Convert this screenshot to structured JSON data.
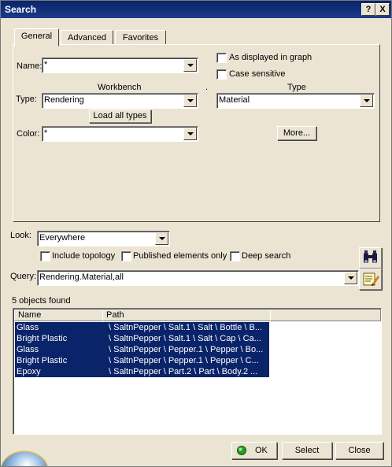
{
  "window": {
    "title": "Search",
    "help": "?",
    "close": "X"
  },
  "tabs": [
    {
      "label": "General"
    },
    {
      "label": "Advanced"
    },
    {
      "label": "Favorites"
    }
  ],
  "general": {
    "name_label": "Name:",
    "name_value": "*",
    "workbench_label": "Workbench",
    "type_label": "Type:",
    "type_value": "Rendering",
    "load_all_types": "Load all types",
    "color_label": "Color:",
    "color_value": "*",
    "as_displayed": "As displayed in graph",
    "case_sensitive": "Case sensitive",
    "type2_label": "Type",
    "type2_value": "Material",
    "more_button": "More...",
    "separator": "."
  },
  "look": {
    "label": "Look:",
    "value": "Everywhere",
    "include_topology": "Include topology",
    "published_only": "Published elements only",
    "deep_search": "Deep search"
  },
  "query": {
    "label": "Query:",
    "value": "Rendering.Material,all"
  },
  "results": {
    "count_text": "5 objects found",
    "headers": {
      "name": "Name",
      "path": "Path"
    },
    "rows": [
      {
        "name": "Glass",
        "path": "\\ SaltnPepper \\ Salt.1 \\ Salt \\ Bottle \\ B..."
      },
      {
        "name": "Bright Plastic",
        "path": "\\ SaltnPepper \\ Salt.1 \\ Salt \\ Cap \\ Ca..."
      },
      {
        "name": "Glass",
        "path": "\\ SaltnPepper \\ Pepper.1 \\ Pepper \\ Bo..."
      },
      {
        "name": "Bright Plastic",
        "path": "\\ SaltnPepper \\ Pepper.1 \\ Pepper \\ C..."
      },
      {
        "name": "Epoxy",
        "path": "\\ SaltnPepper \\ Part.2 \\ Part \\ Body.2 ..."
      }
    ]
  },
  "footer": {
    "ok": "OK",
    "select": "Select",
    "close": "Close"
  },
  "colors": {
    "title_bg": "#0a246a",
    "dialog_bg": "#ece4d3",
    "selection": "#0a246a",
    "ok_icon": "#2a9a2a"
  },
  "icons": [
    "binoculars-icon",
    "query-edit-icon",
    "ok-status-icon",
    "chevron-down-icon"
  ]
}
